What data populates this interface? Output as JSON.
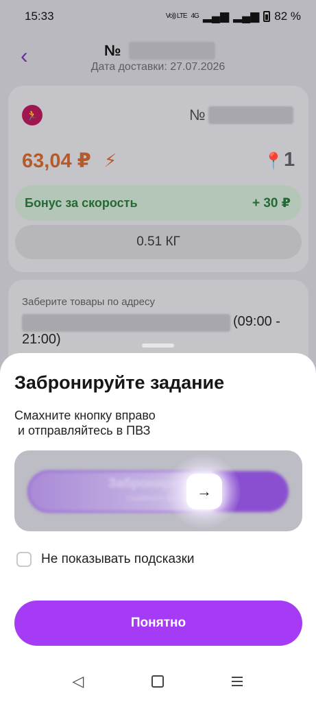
{
  "status_bar": {
    "time": "15:33",
    "volte": "Vo)) LTE",
    "network": "4G",
    "battery": "82 %"
  },
  "header": {
    "order_prefix": "№",
    "delivery_date": "Дата доставки: 27.07.2026"
  },
  "task_card": {
    "number_prefix": "№",
    "price": "63,04 ₽",
    "points_count": "1",
    "bonus_label": "Бонус за скорость",
    "bonus_value": "+ 30 ₽",
    "weight": "0.51 КГ"
  },
  "pickup_card": {
    "label": "Заберите товары по адресу",
    "hours_part1": "(09:00 -",
    "hours_part2": "21:00)"
  },
  "sheet": {
    "title": "Забронируйте задание",
    "description": "Смахните кнопку вправо\n и отправляйтесь в ПВЗ",
    "slider_label": "Забронировать",
    "slider_sublabel": "Свайпните вправо",
    "checkbox_label": "Не показывать подсказки",
    "confirm_button": "Понятно"
  },
  "icons": {
    "back": "chevron-left-icon",
    "task": "runner-icon",
    "bolt": "lightning-icon",
    "pin": "map-pin-icon",
    "thumb": "arrow-right-icon"
  },
  "colors": {
    "accent": "#a63bf5",
    "price": "#b55a2a",
    "bonus": "#256a34"
  }
}
